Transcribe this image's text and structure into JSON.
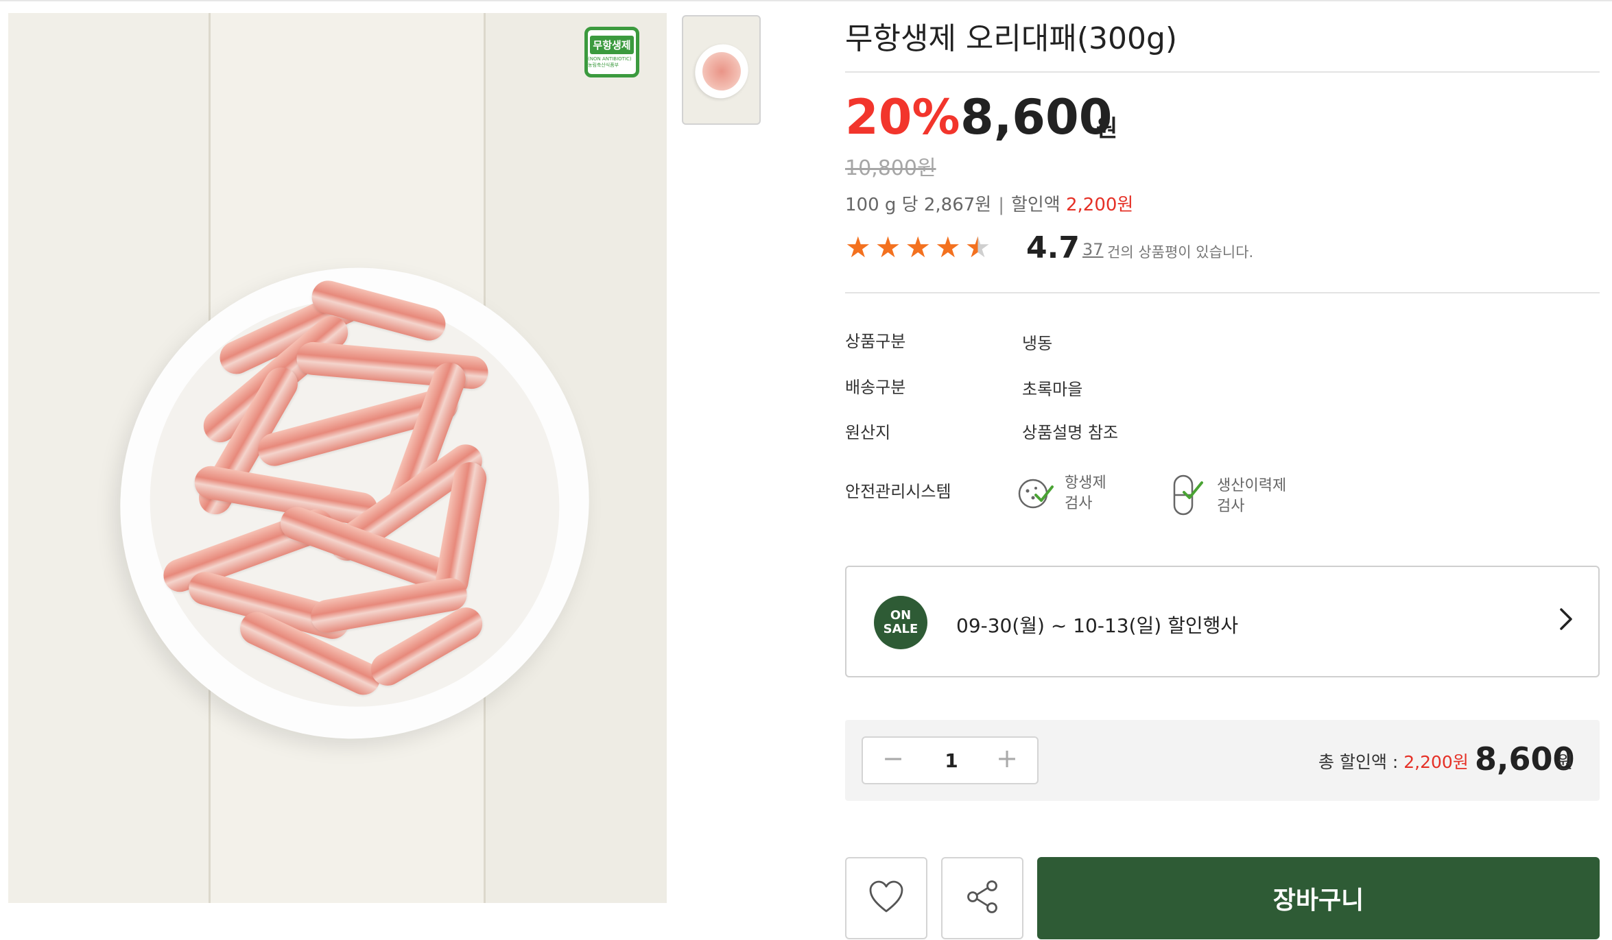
{
  "product": {
    "title": "무항생제 오리대패(300g)",
    "badge": {
      "text": "무항생제",
      "sub": "(NON ANTIBIOTIC) 농림축산식품부"
    },
    "discount_rate": "20%",
    "sale_price": "8,600",
    "currency": "원",
    "original_price": "10,800원",
    "unit_price": "100 g 당 2,867원",
    "discount_label": "할인액",
    "discount_amount": "2,200원",
    "rating": "4.7",
    "rating_value": 4.7,
    "review_count": "37",
    "review_suffix": "건의 상품평이 있습니다.",
    "accent_color": "#f2352c",
    "star_color": "#f3711f",
    "brand_green": "#2e5b35"
  },
  "specs": [
    {
      "label": "상품구분",
      "value": "냉동"
    },
    {
      "label": "배송구분",
      "value": "초록마을"
    },
    {
      "label": "원산지",
      "value": "상품설명 참조"
    }
  ],
  "safety": {
    "label": "안전관리시스템",
    "items": [
      {
        "line1": "항생제",
        "line2": "검사",
        "icon": "antibiotic-test-icon"
      },
      {
        "line1": "생산이력제",
        "line2": "검사",
        "icon": "traceability-test-icon"
      }
    ]
  },
  "sale_event": {
    "badge_line1": "ON",
    "badge_line2": "SALE",
    "text": "09-30(월) ~ 10-13(일) 할인행사"
  },
  "quantity": {
    "value": "1",
    "total_discount_label": "총 할인액 : ",
    "total_discount": "2,200원",
    "total_price": "8,600",
    "total_unit": "원"
  },
  "actions": {
    "cart_label": "장바구니",
    "wishlist_icon": "heart-icon",
    "share_icon": "share-icon"
  }
}
